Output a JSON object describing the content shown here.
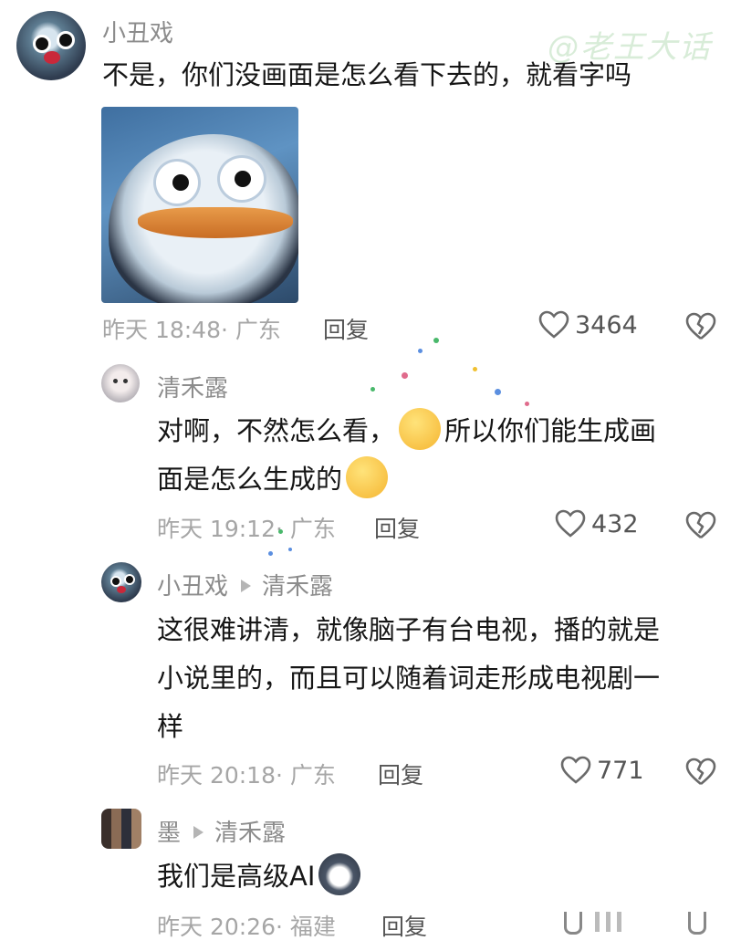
{
  "watermark": "@老王大话",
  "comments": [
    {
      "author": "小丑戏",
      "text": "不是，你们没画面是怎么看下去的，就看字吗",
      "time": "昨天 18:48",
      "location": "· 广东",
      "reply_label": "回复",
      "likes": "3464"
    },
    {
      "author": "清禾露",
      "text_a": "对啊，不然怎么看，",
      "text_b": "所以你们能生成画",
      "text_c": "面是怎么生成的",
      "emoji_1": "thinking-face-emoji",
      "emoji_2": "pleading-face-emoji",
      "time": "昨天 19:12",
      "location": "· 广东",
      "reply_label": "回复",
      "likes": "432"
    },
    {
      "author": "小丑戏",
      "reply_to": "清禾露",
      "line1": "这很难讲清，就像脑子有台电视，播的就是",
      "line2": "小说里的，而且可以随着词走形成电视剧一",
      "line3": "样",
      "time": "昨天 20:18",
      "location": "· 广东",
      "reply_label": "回复",
      "likes": "771"
    },
    {
      "author": "墨",
      "reply_to": "清禾露",
      "text": "我们是高级AI",
      "emoji": "husky-face-emoji",
      "time": "昨天 20:26",
      "location": "· 福建",
      "reply_label": "回复"
    }
  ],
  "icons": [
    "heart-icon",
    "broken-heart-icon",
    "arrow-right-icon"
  ],
  "colors": {
    "meta": "#a6a6a6",
    "text": "#161616",
    "watermark": "#d8ecd8"
  }
}
